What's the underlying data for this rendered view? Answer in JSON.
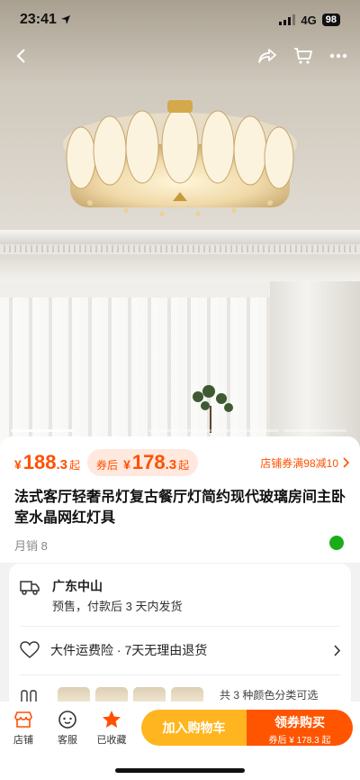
{
  "status": {
    "time": "23:41",
    "network": "4G",
    "battery": "98"
  },
  "product": {
    "price_yen": "¥",
    "price_int": "188",
    "price_dec": ".3",
    "price_suffix": "起",
    "coupon_tag": "券后",
    "coupon_yen": "¥",
    "coupon_int": "178",
    "coupon_dec": ".3",
    "coupon_suffix": "起",
    "store_coupon": "店铺券满98减10",
    "title": "法式客厅轻奢吊灯复古餐厅灯简约现代玻璃房间主卧室水晶网红灯具",
    "sales": "月销 8"
  },
  "shipping": {
    "origin": "广东中山",
    "note": "预售，付款后 3 天内发货"
  },
  "assurance": {
    "text": "大件运费险 · 7天无理由退货"
  },
  "sku": {
    "more": "共 3 种颜色分类可选"
  },
  "tabs": [
    {
      "label": "店铺"
    },
    {
      "label": "客服"
    },
    {
      "label": "已收藏"
    }
  ],
  "actions": {
    "cart": "加入购物车",
    "buy": "领券购买",
    "buy_sub": "券后 ¥ 178.3 起"
  },
  "colors": {
    "accent": "#ff5000",
    "cart": "#ffb51f",
    "buy": "#ff5500"
  }
}
